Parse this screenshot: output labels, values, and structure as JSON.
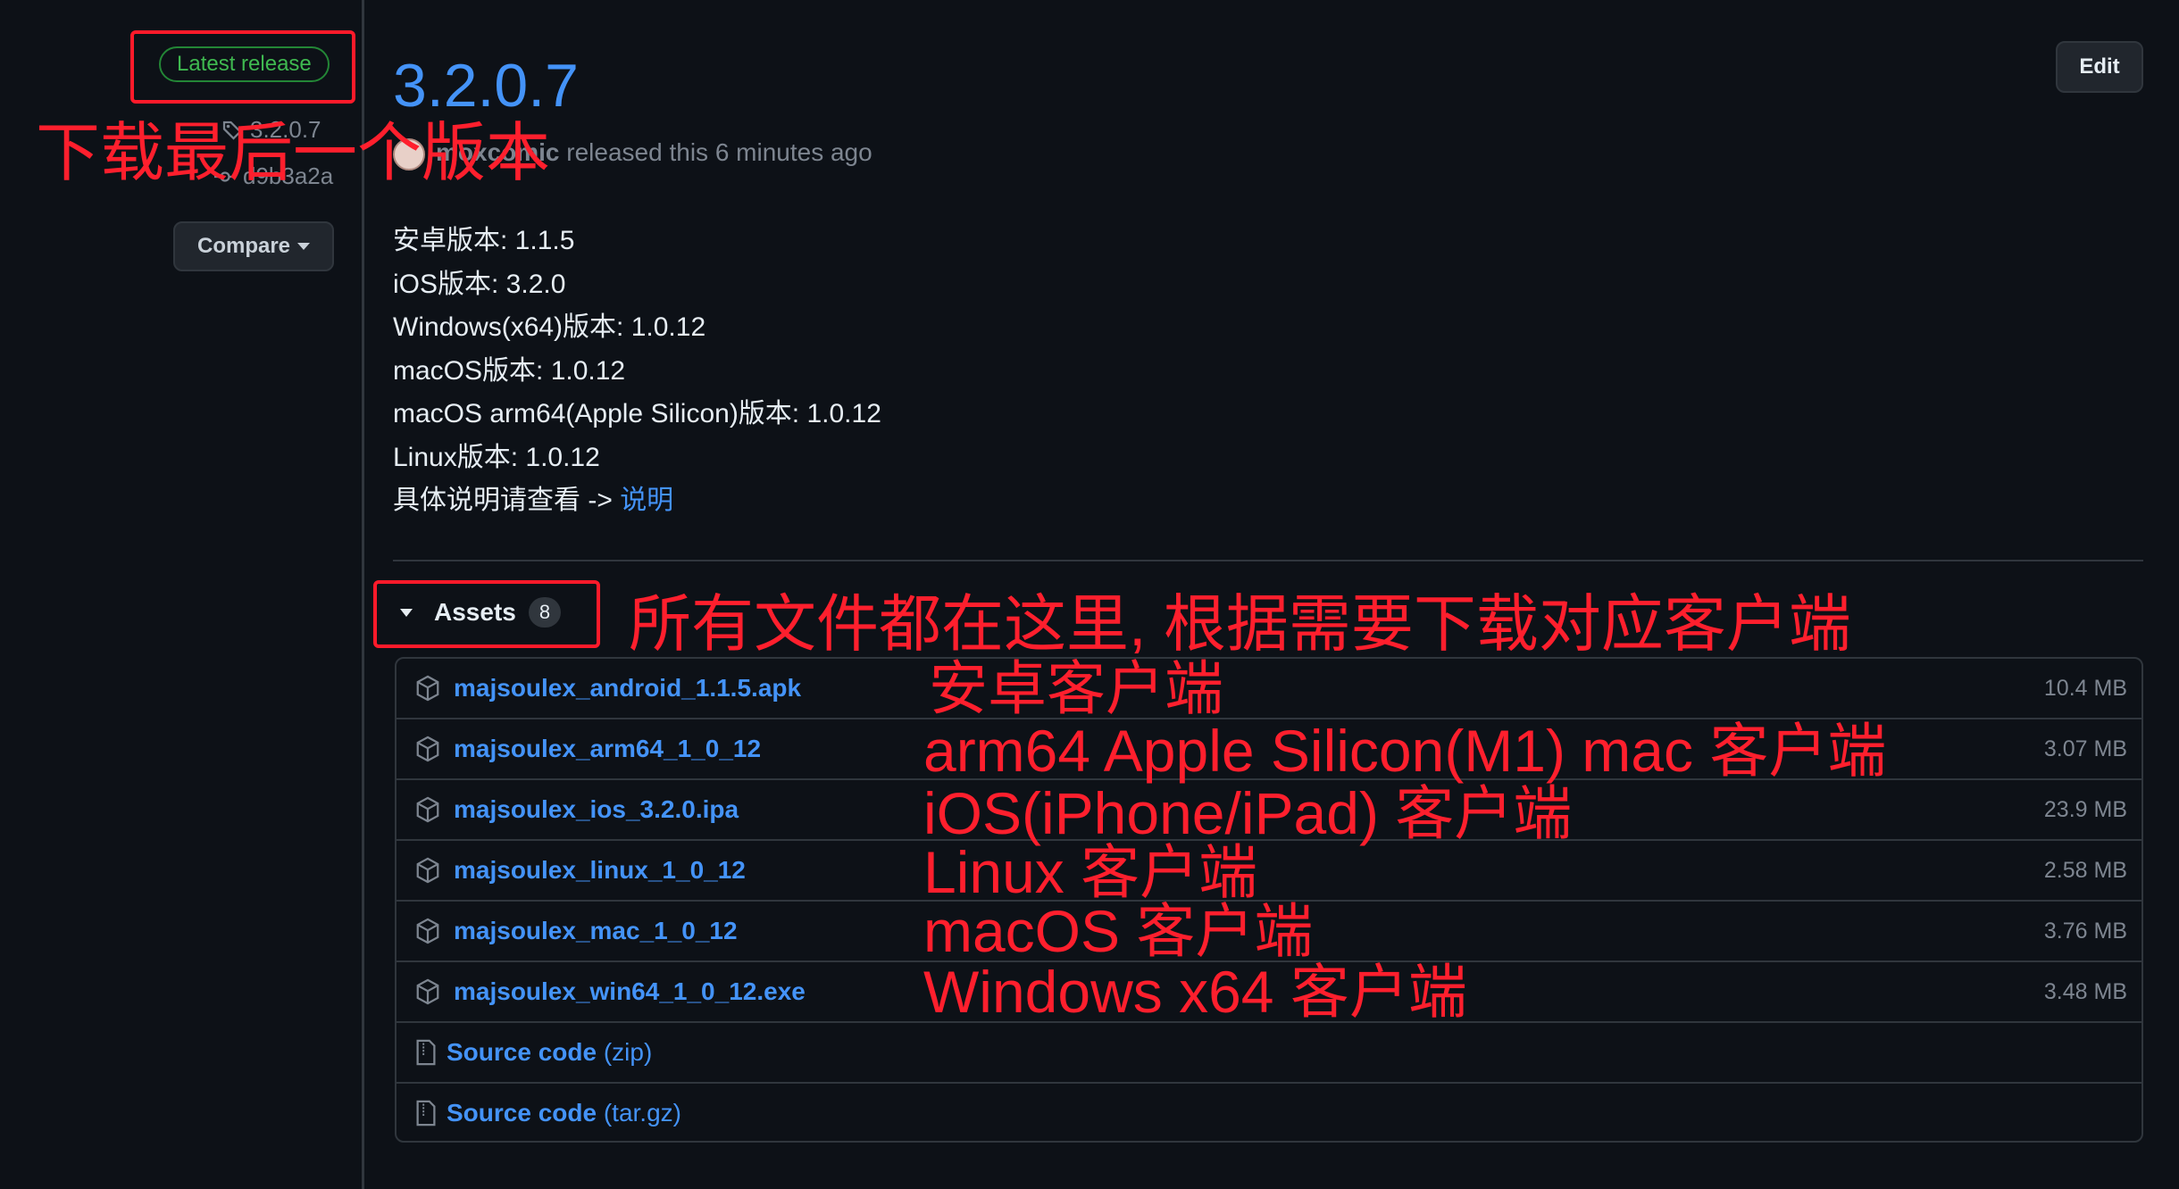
{
  "sidebar": {
    "badge": "Latest release",
    "tag": "3.2.0.7",
    "commit": "d9b3a2a",
    "compare": "Compare"
  },
  "release": {
    "title": "3.2.0.7",
    "author": "moxcomic",
    "released_text": " released this 6 minutes ago",
    "edit": "Edit",
    "notes": [
      "安卓版本: 1.1.5",
      "iOS版本: 3.2.0",
      "Windows(x64)版本: 1.0.12",
      "macOS版本: 1.0.12",
      "macOS arm64(Apple Silicon)版本: 1.0.12",
      "Linux版本: 1.0.12"
    ],
    "notes_last_prefix": "具体说明请查看 -> ",
    "notes_last_link": "说明"
  },
  "assets": {
    "label": "Assets",
    "count": "8",
    "files": [
      {
        "name": "majsoulex_android_1.1.5.apk",
        "size": "10.4 MB"
      },
      {
        "name": "majsoulex_arm64_1_0_12",
        "size": "3.07 MB"
      },
      {
        "name": "majsoulex_ios_3.2.0.ipa",
        "size": "23.9 MB"
      },
      {
        "name": "majsoulex_linux_1_0_12",
        "size": "2.58 MB"
      },
      {
        "name": "majsoulex_mac_1_0_12",
        "size": "3.76 MB"
      },
      {
        "name": "majsoulex_win64_1_0_12.exe",
        "size": "3.48 MB"
      }
    ],
    "source": [
      {
        "label": "Source code",
        "format": "(zip)"
      },
      {
        "label": "Source code",
        "format": "(tar.gz)"
      }
    ]
  },
  "annotations": {
    "latest_note": "下载最后一个版本",
    "assets_note": "所有文件都在这里, 根据需要下载对应客户端",
    "android": "安卓客户端",
    "arm64": "arm64 Apple Silicon(M1) mac 客户端",
    "ios": "iOS(iPhone/iPad) 客户端",
    "linux": "Linux 客户端",
    "mac": "macOS 客户端",
    "windows": "Windows x64 客户端",
    "color": "#ff1f2d"
  },
  "colors": {
    "background": "#0d1117",
    "link": "#4493f8",
    "badge_green": "#3fb950",
    "muted": "#7d8590",
    "border": "#30363d"
  }
}
